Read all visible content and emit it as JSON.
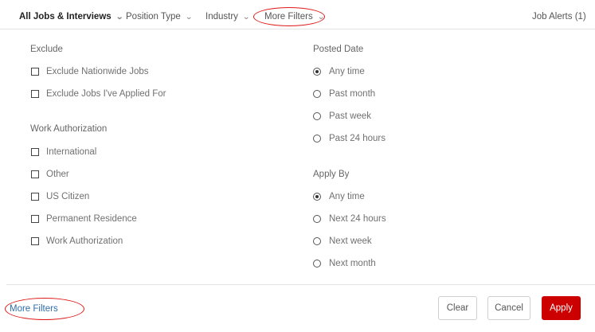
{
  "topbar": {
    "all_jobs": "All Jobs & Interviews",
    "position_type": "Position Type",
    "industry": "Industry",
    "more_filters": "More Filters",
    "job_alerts": "Job Alerts (1)"
  },
  "exclude": {
    "title": "Exclude",
    "options": [
      "Exclude Nationwide Jobs",
      "Exclude Jobs I've Applied For"
    ]
  },
  "work_authorization": {
    "title": "Work Authorization",
    "options": [
      "International",
      "Other",
      "US Citizen",
      "Permanent Residence",
      "Work Authorization"
    ]
  },
  "posted_date": {
    "title": "Posted Date",
    "selected": "Any time",
    "options": [
      "Any time",
      "Past month",
      "Past week",
      "Past 24 hours"
    ]
  },
  "apply_by": {
    "title": "Apply By",
    "selected": "Any time",
    "options": [
      "Any time",
      "Next 24 hours",
      "Next week",
      "Next month"
    ]
  },
  "footer": {
    "more_filters": "More Filters",
    "clear": "Clear",
    "cancel": "Cancel",
    "apply": "Apply"
  },
  "colors": {
    "accent": "#cc0000",
    "highlight_oval": "#e01818",
    "link": "#2f6ea8"
  }
}
